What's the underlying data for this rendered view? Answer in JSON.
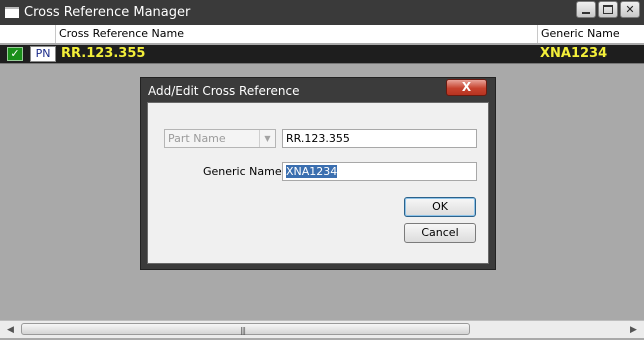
{
  "window": {
    "title": "Cross Reference Manager",
    "close_glyph": "✕"
  },
  "grid": {
    "columns": [
      "Cross Reference Name",
      "Generic Name"
    ],
    "rows": [
      {
        "checked": true,
        "check_glyph": "✓",
        "type_badge": "PN",
        "xref_name": "RR.123.355",
        "generic_name": "XNA1234"
      }
    ]
  },
  "scrollbar": {
    "left_arrow": "◀",
    "right_arrow": "▶",
    "grip": "|||"
  },
  "dialog": {
    "title": "Add/Edit  Cross Reference",
    "close_label": "X",
    "type_select": {
      "value": "Part Name",
      "arrow": "▼"
    },
    "part_value": "RR.123.355",
    "generic_label": "Generic Name :",
    "generic_value": "XNA1234",
    "ok_label": "OK",
    "cancel_label": "Cancel"
  },
  "colors": {
    "row_bg": "#1e1e1e",
    "row_text": "#f3ef3a",
    "title_bg": "#3a3a3a",
    "check_green": "#1a8f1a",
    "selection": "#3b6fb0"
  }
}
